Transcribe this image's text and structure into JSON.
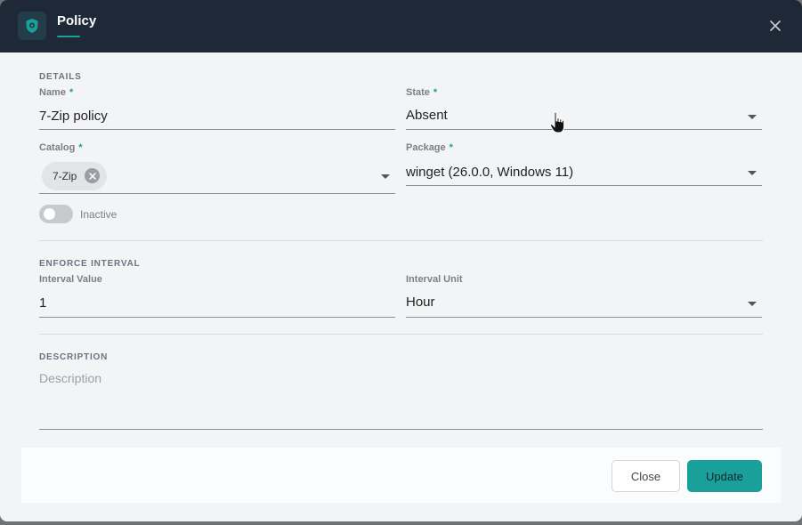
{
  "dialog": {
    "title": "Policy",
    "close_icon": "close-icon",
    "logo_icon": "shield-icon"
  },
  "details": {
    "section_label": "DETAILS",
    "name": {
      "label": "Name",
      "required": "*",
      "value": "7-Zip policy"
    },
    "state": {
      "label": "State",
      "required": "*",
      "value": "Absent"
    },
    "catalog": {
      "label": "Catalog",
      "required": "*",
      "chip": "7-Zip"
    },
    "package": {
      "label": "Package",
      "required": "*",
      "value": "winget (26.0.0, Windows 11)"
    },
    "toggle": {
      "label": "Inactive",
      "on": false
    }
  },
  "enforce": {
    "section_label": "ENFORCE INTERVAL",
    "interval_value": {
      "label": "Interval Value",
      "value": "1"
    },
    "interval_unit": {
      "label": "Interval Unit",
      "value": "Hour"
    }
  },
  "description": {
    "section_label": "DESCRIPTION",
    "placeholder": "Description"
  },
  "footer": {
    "close_label": "Close",
    "update_label": "Update"
  },
  "colors": {
    "titlebar": "#1e2837",
    "accent": "#1aa09a",
    "background": "#f3f4f6"
  }
}
